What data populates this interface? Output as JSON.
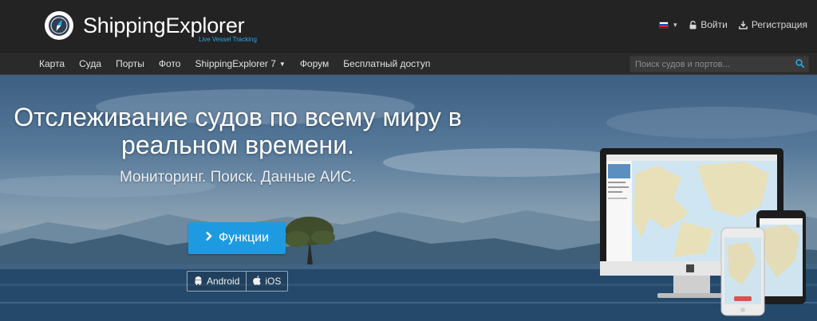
{
  "header": {
    "brand_name": "ShippingExplorer",
    "tagline": "Live Vessel Tracking",
    "login_label": "Войти",
    "register_label": "Регистрация"
  },
  "nav": {
    "items": [
      {
        "label": "Карта"
      },
      {
        "label": "Суда"
      },
      {
        "label": "Порты"
      },
      {
        "label": "Фото"
      },
      {
        "label": "ShippingExplorer 7",
        "has_dropdown": true
      },
      {
        "label": "Форум"
      },
      {
        "label": "Бесплатный доступ"
      }
    ],
    "search_placeholder": "Поиск судов и портов..."
  },
  "hero": {
    "title_line1": "Отслеживание судов по всему миру в",
    "title_line2": "реальном времени.",
    "subtitle": "Мониторинг. Поиск. Данные АИС.",
    "features_button": "Функции",
    "android_label": "Android",
    "ios_label": "iOS"
  },
  "colors": {
    "header_bg": "#232323",
    "nav_bg": "#2a2a2a",
    "accent": "#1e9be0",
    "tagline": "#2aa6e8"
  },
  "icons": {
    "logo": "compass-icon",
    "language": "russia-flag-icon",
    "login": "lock-icon",
    "register": "download-icon",
    "search": "search-icon",
    "features": "chevron-right-icon",
    "android": "android-icon",
    "ios": "apple-icon"
  }
}
